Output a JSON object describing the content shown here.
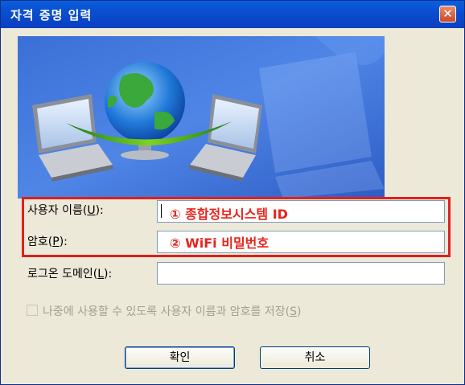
{
  "window": {
    "title": "자격 증명 입력",
    "close_glyph": "✕"
  },
  "form": {
    "username_label_pre": "사용자 이름(",
    "username_label_key": "U",
    "username_label_post": "):",
    "username_annotation": "① 종합정보시스템 ID",
    "password_label_pre": "암호(",
    "password_label_key": "P",
    "password_label_post": "):",
    "password_annotation": "② WiFi 비밀번호",
    "domain_label_pre": "로그온 도메인(",
    "domain_label_key": "L",
    "domain_label_post": "):",
    "remember_label_pre": "나중에 사용할 수 있도록 사용자 이름과 암호를 저장(",
    "remember_label_key": "S",
    "remember_label_post": ")"
  },
  "buttons": {
    "ok": "확인",
    "cancel": "취소"
  },
  "colors": {
    "annotation": "#e8241c",
    "titlebar": "#0a4fd0"
  }
}
